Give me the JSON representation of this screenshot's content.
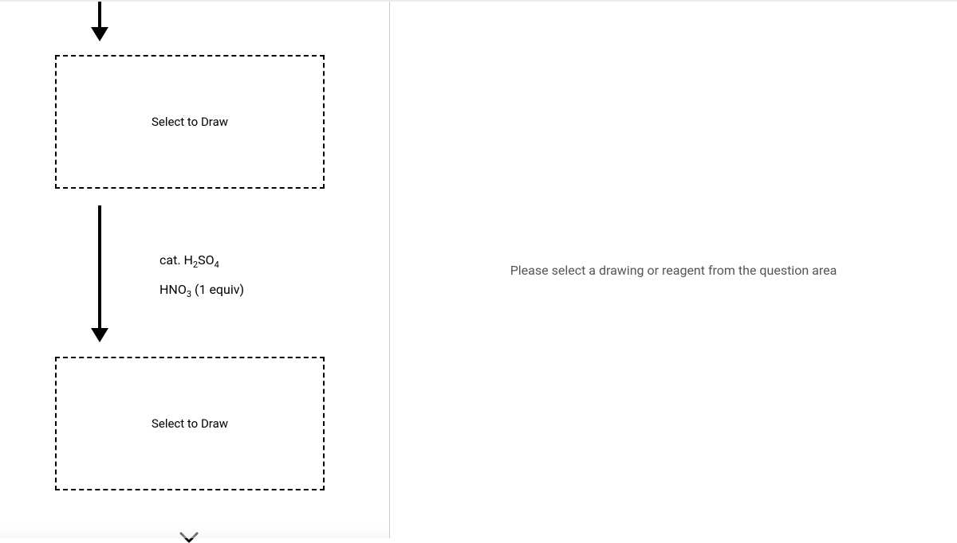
{
  "leftPanel": {
    "drawBoxes": [
      {
        "label": "Select to Draw"
      },
      {
        "label": "Select to Draw"
      }
    ],
    "reagents": {
      "line1_pre": "cat. H",
      "line1_sub1": "2",
      "line1_mid": "SO",
      "line1_sub2": "4",
      "line2_pre": "HNO",
      "line2_sub": "3",
      "line2_post": " (1 equiv)"
    }
  },
  "rightPanel": {
    "placeholder": "Please select a drawing or reagent from the question area"
  }
}
